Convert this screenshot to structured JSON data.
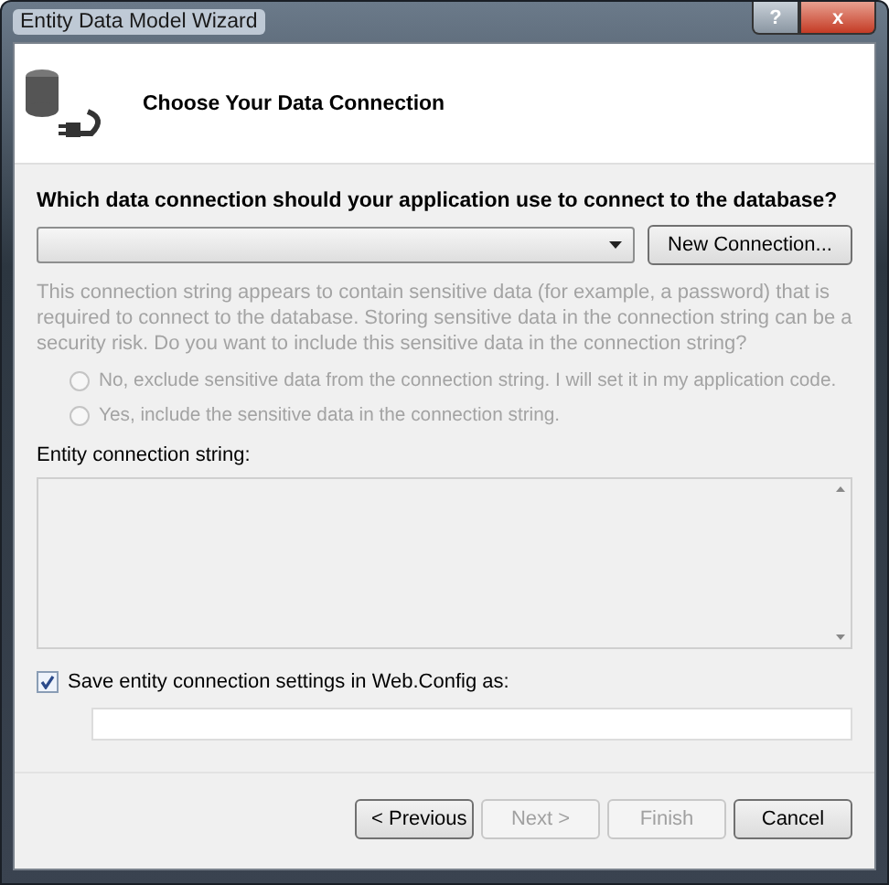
{
  "window": {
    "title": "Entity Data Model Wizard",
    "buttons": [
      {
        "kind": "help",
        "label": "?"
      },
      {
        "kind": "close",
        "label": "x"
      }
    ]
  },
  "header": {
    "title": "Choose Your Data Connection"
  },
  "question": "Which data connection should your application use to connect to the database?",
  "connection_dropdown": {
    "disabled": false
  },
  "new_connection_button": {
    "label": "New Connection...",
    "disabled": false
  },
  "sensitive_notice": {
    "text": "This connection string appears to contain sensitive data (for example, a password) that is required to connect to the database. Storing sensitive data in the connection string can be a security risk. Do you want to include this sensitive data in the connection string?",
    "disabled": true
  },
  "sensitive_options": [
    {
      "label": "No, exclude sensitive data from the connection string. I will set it in my application code.",
      "selected": false,
      "disabled": true
    },
    {
      "label": "Yes, include the sensitive data in the connection string.",
      "selected": false,
      "disabled": true
    }
  ],
  "connection_string": {
    "label": "Entity connection string:"
  },
  "save_setting": {
    "label": "Save entity connection settings in Web.Config as:",
    "checked": true
  },
  "footer_buttons": [
    {
      "label": "< Previous",
      "disabled": false
    },
    {
      "label": "Next >",
      "disabled": true
    },
    {
      "label": "Finish",
      "disabled": true
    },
    {
      "label": "Cancel",
      "disabled": false
    }
  ]
}
